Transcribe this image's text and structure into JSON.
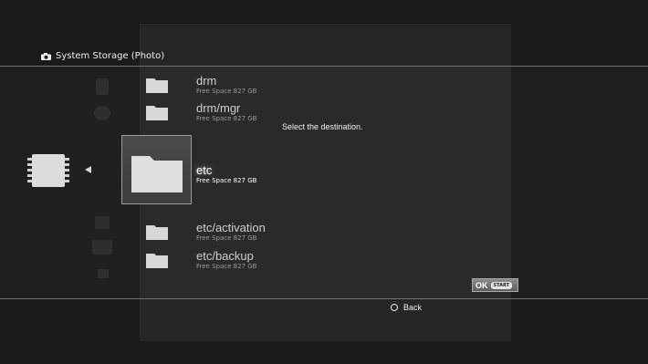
{
  "header": {
    "title": "System Storage (Photo)",
    "icon": "camera-icon"
  },
  "prompt": "Select the destination.",
  "folders": [
    {
      "name": "drm",
      "free": "Free Space  827 GB"
    },
    {
      "name": "drm/mgr",
      "free": "Free Space  827 GB"
    },
    {
      "name": "etc",
      "free": "Free Space  827 GB",
      "selected": true
    },
    {
      "name": "etc/activation",
      "free": "Free Space  827 GB"
    },
    {
      "name": "etc/backup",
      "free": "Free Space  827 GB"
    }
  ],
  "ok_button": {
    "label": "OK",
    "sub": "START"
  },
  "back": {
    "label": "Back",
    "icon": "circle-button-icon"
  },
  "device": {
    "icon": "memory-chip-icon"
  },
  "colors": {
    "background": "#1b1b1b",
    "text": "#ffffff",
    "dim_text": "#9a9a9a"
  }
}
